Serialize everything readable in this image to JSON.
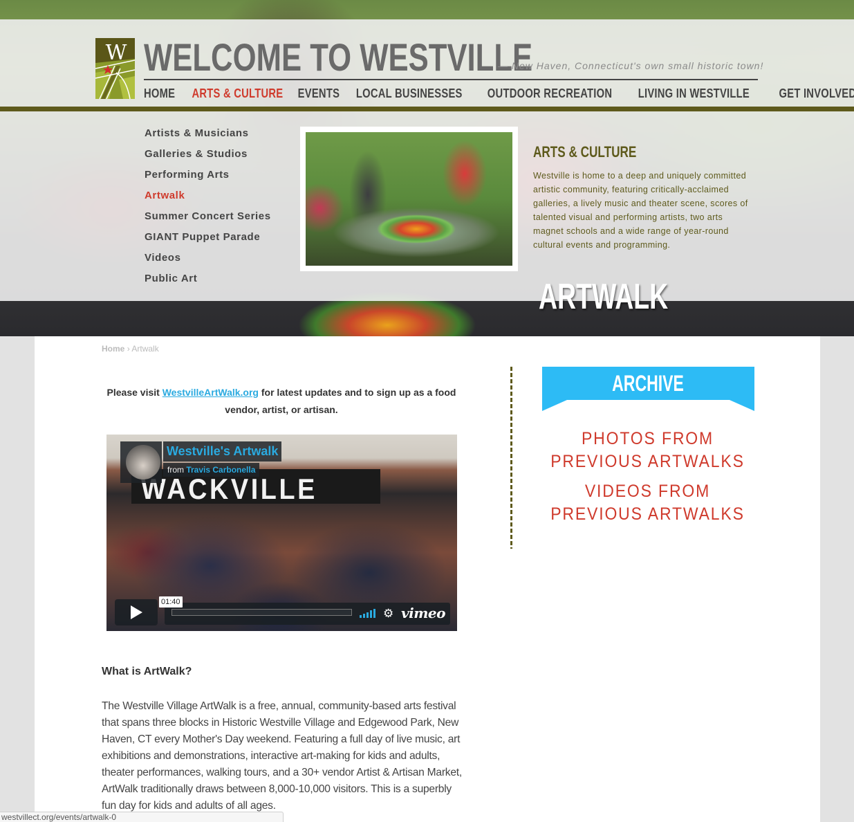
{
  "header": {
    "site_title": "WELCOME TO WESTVILLE",
    "tagline": "—  New Haven, Connecticut's own small historic town!",
    "logo_letter": "W"
  },
  "main_nav": [
    {
      "label": "HOME",
      "active": false
    },
    {
      "label": "ARTS & CULTURE",
      "active": true
    },
    {
      "label": "EVENTS",
      "active": false
    },
    {
      "label": "LOCAL BUSINESSES",
      "active": false
    },
    {
      "label": "OUTDOOR RECREATION",
      "active": false
    },
    {
      "label": "LIVING IN WESTVILLE",
      "active": false
    },
    {
      "label": "GET INVOLVED",
      "active": false
    }
  ],
  "sub_nav": [
    {
      "label": "Artists & Musicians",
      "active": false
    },
    {
      "label": "Galleries & Studios",
      "active": false
    },
    {
      "label": "Performing Arts",
      "active": false
    },
    {
      "label": "Artwalk",
      "active": true
    },
    {
      "label": "Summer Concert Series",
      "active": false
    },
    {
      "label": "GIANT Puppet Parade",
      "active": false
    },
    {
      "label": "Videos",
      "active": false
    },
    {
      "label": "Public Art",
      "active": false
    }
  ],
  "section": {
    "heading": "ARTS & CULTURE",
    "description": "Westville is home to a deep and uniquely committed artistic community, featuring critically-acclaimed galleries, a lively music and theater scene, scores of talented visual and performing artists, two arts magnet schools and a wide range of year-round cultural events and programming."
  },
  "page_title": "ARTWALK",
  "breadcrumb": {
    "home": "Home",
    "separator": "›",
    "current": "Artwalk"
  },
  "intro": {
    "prefix": "Please visit ",
    "link_text": "WestvilleArtWalk.org",
    "suffix": " for latest updates and to sign up as a food vendor, artist, or artisan."
  },
  "video": {
    "title": "Westville's Artwalk",
    "from_label": "from",
    "author": "Travis Carbonella",
    "duration": "01:40",
    "provider": "vimeo",
    "banner_text": "WACKVILLE"
  },
  "article": {
    "heading": "What is ArtWalk?",
    "body": "The Westville Village ArtWalk is a free, annual, community-based arts festival that spans three blocks in Historic Westville Village and Edgewood Park, New Haven, CT every Mother's Day weekend. Featuring a full day of live music, art exhibitions and demonstrations, interactive art-making for kids and adults, theater performances, walking tours, and a 30+ vendor Artist & Artisan Market, ArtWalk traditionally draws between 8,000-10,000 visitors. This is a superbly fun day for kids and adults of all ages."
  },
  "archive": {
    "heading": "ARCHIVE",
    "links": [
      "PHOTOS FROM PREVIOUS ARTWALKS",
      "VIDEOS FROM PREVIOUS ARTWALKS"
    ]
  },
  "status_bar": {
    "url": "westvillect.org/events/artwalk-0"
  },
  "colors": {
    "accent_red": "#cf3a2c",
    "olive": "#5e5a1c",
    "archive_blue": "#2dbbf5",
    "link_blue": "#2aaae0"
  }
}
